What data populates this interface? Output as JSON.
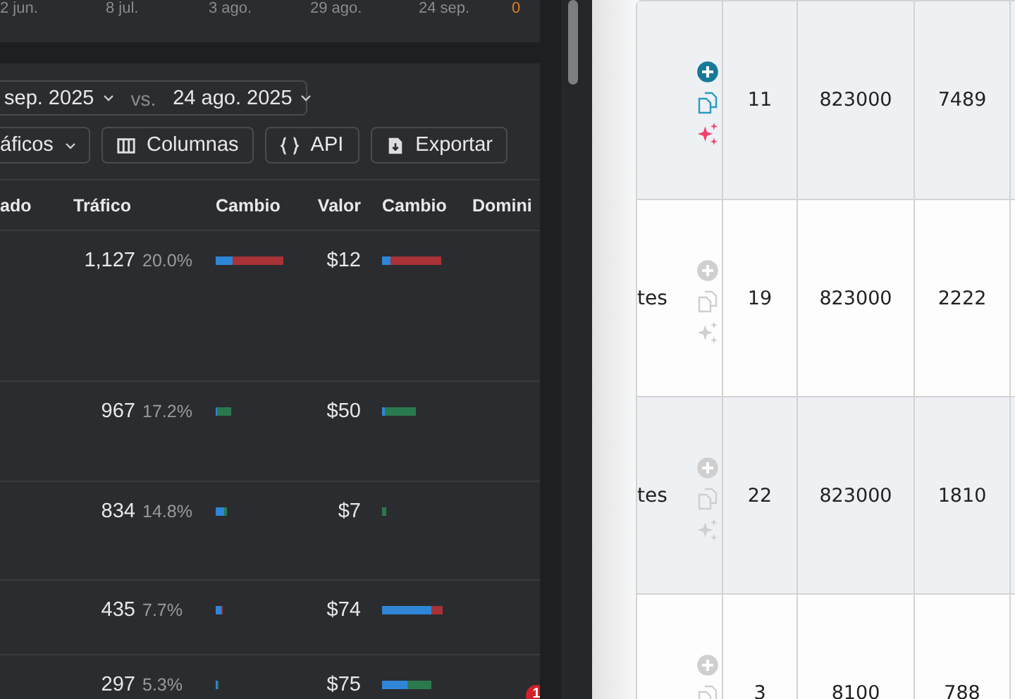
{
  "timeline": {
    "dates": [
      "2 jun.",
      "8 jul.",
      "3 ago.",
      "29 ago.",
      "24 sep."
    ],
    "count": "0"
  },
  "compare": {
    "current": "sep. 2025",
    "vs": "vs.",
    "previous": "24 ago. 2025"
  },
  "toolbar": [
    {
      "label": "áficos",
      "kind": "dropdown"
    },
    {
      "label": "Columnas",
      "kind": "columns"
    },
    {
      "label": "API",
      "kind": "api"
    },
    {
      "label": "Exportar",
      "kind": "export"
    }
  ],
  "table": {
    "columns": [
      "ado",
      "Tráfico",
      "Cambio",
      "Valor",
      "Cambio",
      "Domini"
    ],
    "rows": [
      {
        "traffic": "1,127",
        "share": "20.0%",
        "value": "$12"
      },
      {
        "traffic": "967",
        "share": "17.2%",
        "value": "$50"
      },
      {
        "traffic": "834",
        "share": "14.8%",
        "value": "$7"
      },
      {
        "traffic": "435",
        "share": "7.7%",
        "value": "$74"
      },
      {
        "traffic": "297",
        "share": "5.3%",
        "value": "$75"
      }
    ]
  },
  "notification_count": "1",
  "keyword_table": {
    "rows": [
      {
        "column_1": null,
        "selected": true,
        "column_2": "11",
        "column_3": "823000",
        "column_4": "7489"
      },
      {
        "column_1": "tes",
        "selected": false,
        "column_2": "19",
        "column_3": "823000",
        "column_4": "2222"
      },
      {
        "column_1": "tes",
        "selected": false,
        "column_2": "22",
        "column_3": "823000",
        "column_4": "1810"
      },
      {
        "column_1": null,
        "selected": false,
        "column_2": "3",
        "column_3": "8100",
        "column_4": "788"
      }
    ]
  }
}
